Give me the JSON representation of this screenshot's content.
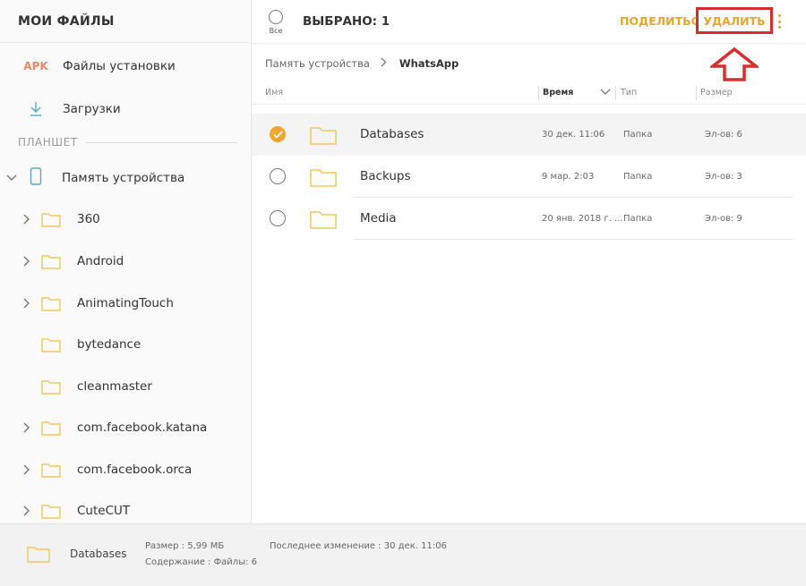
{
  "colors": {
    "accent": "#e4a72c",
    "check": "#f2a531",
    "highlight": "#d62e2e",
    "folder": "#f2c75a"
  },
  "sidebar": {
    "title": "МОИ ФАЙЛЫ",
    "apk_badge": "APK",
    "items": [
      {
        "label": "Файлы установки",
        "icon": "apk-icon"
      },
      {
        "label": "Загрузки",
        "icon": "download-icon"
      }
    ],
    "section": "ПЛАНШЕТ",
    "device": {
      "label": "Память устройства",
      "icon": "phone-icon"
    },
    "folders": [
      {
        "label": "360",
        "expandable": true
      },
      {
        "label": "Android",
        "expandable": true
      },
      {
        "label": "AnimatingTouch",
        "expandable": true
      },
      {
        "label": "bytedance",
        "expandable": false
      },
      {
        "label": "cleanmaster",
        "expandable": false
      },
      {
        "label": "com.facebook.katana",
        "expandable": true
      },
      {
        "label": "com.facebook.orca",
        "expandable": true
      },
      {
        "label": "CuteCUT",
        "expandable": true
      }
    ]
  },
  "toolbar": {
    "select_all_label": "Все",
    "selected_title": "ВЫБРАНО: 1",
    "share_label": "ПОДЕЛИТЬСЯ",
    "delete_label": "УДАЛИТЬ"
  },
  "breadcrumb": {
    "root": "Память устройства",
    "current": "WhatsApp"
  },
  "columns": {
    "name": "Имя",
    "time": "Время",
    "type": "Тип",
    "size": "Размер"
  },
  "files": [
    {
      "name": "Databases",
      "time": "30 дек. 11:06",
      "type": "Папка",
      "size": "Эл-ов: 6",
      "selected": true
    },
    {
      "name": "Backups",
      "time": "9 мар. 2:03",
      "type": "Папка",
      "size": "Эл-ов: 3",
      "selected": false
    },
    {
      "name": "Media",
      "time": "20 янв. 2018 г. ...",
      "type": "Папка",
      "size": "Эл-ов: 9",
      "selected": false
    }
  ],
  "details": {
    "name": "Databases",
    "size": "Размер : 5,99 МБ",
    "contents": "Содержание : Файлы: 6",
    "modified": "Последнее изменение : 30 дек. 11:06"
  }
}
